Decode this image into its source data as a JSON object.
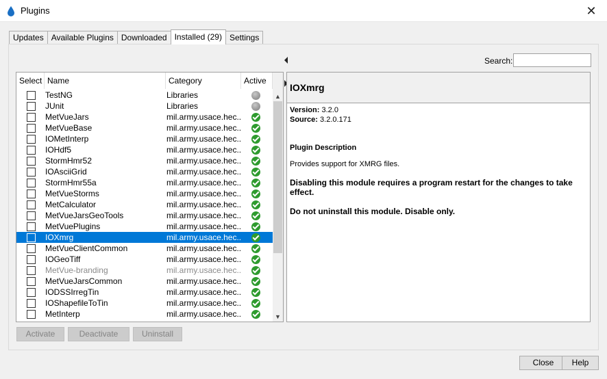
{
  "window": {
    "title": "Plugins"
  },
  "tabs": [
    {
      "label": "Updates"
    },
    {
      "label": "Available Plugins"
    },
    {
      "label": "Downloaded"
    },
    {
      "label": "Installed (29)"
    },
    {
      "label": "Settings"
    }
  ],
  "search": {
    "label": "Search:",
    "value": ""
  },
  "table": {
    "columns": [
      "Select",
      "Name",
      "Category",
      "Active"
    ],
    "rows": [
      {
        "name": "TestNG",
        "category": "Libraries",
        "active": "gray"
      },
      {
        "name": "JUnit",
        "category": "Libraries",
        "active": "gray"
      },
      {
        "name": "MetVueJars",
        "category": "mil.army.usace.hec...",
        "active": "green"
      },
      {
        "name": "MetVueBase",
        "category": "mil.army.usace.hec...",
        "active": "green"
      },
      {
        "name": "IOMetInterp",
        "category": "mil.army.usace.hec...",
        "active": "green"
      },
      {
        "name": "IOHdf5",
        "category": "mil.army.usace.hec...",
        "active": "green"
      },
      {
        "name": "StormHmr52",
        "category": "mil.army.usace.hec...",
        "active": "green"
      },
      {
        "name": "IOAsciiGrid",
        "category": "mil.army.usace.hec...",
        "active": "green"
      },
      {
        "name": "StormHmr55a",
        "category": "mil.army.usace.hec...",
        "active": "green"
      },
      {
        "name": "MetVueStorms",
        "category": "mil.army.usace.hec...",
        "active": "green"
      },
      {
        "name": "MetCalculator",
        "category": "mil.army.usace.hec...",
        "active": "green"
      },
      {
        "name": "MetVueJarsGeoTools",
        "category": "mil.army.usace.hec...",
        "active": "green"
      },
      {
        "name": "MetVuePlugins",
        "category": "mil.army.usace.hec...",
        "active": "green"
      },
      {
        "name": "IOXmrg",
        "category": "mil.army.usace.hec...",
        "active": "green",
        "selected": true
      },
      {
        "name": "MetVueClientCommon",
        "category": "mil.army.usace.hec...",
        "active": "green"
      },
      {
        "name": "IOGeoTiff",
        "category": "mil.army.usace.hec...",
        "active": "green"
      },
      {
        "name": "MetVue-branding",
        "category": "mil.army.usace.hec...",
        "active": "green",
        "dimmed": true
      },
      {
        "name": "MetVueJarsCommon",
        "category": "mil.army.usace.hec...",
        "active": "green"
      },
      {
        "name": "IODSSIrregTin",
        "category": "mil.army.usace.hec...",
        "active": "green"
      },
      {
        "name": "IOShapefileToTin",
        "category": "mil.army.usace.hec...",
        "active": "green"
      },
      {
        "name": "MetInterp",
        "category": "mil.army.usace.hec...",
        "active": "green"
      }
    ]
  },
  "detail": {
    "title": "IOXmrg",
    "version_label": "Version:",
    "version": "3.2.0",
    "source_label": "Source:",
    "source": "3.2.0.171",
    "description_title": "Plugin Description",
    "description": "Provides support for XMRG files.",
    "warning_restart": "Disabling this module requires a program restart for the changes to take effect.",
    "warning_uninstall": "Do not uninstall this module. Disable only."
  },
  "actions": {
    "activate": "Activate",
    "deactivate": "Deactivate",
    "uninstall": "Uninstall"
  },
  "footer": {
    "close": "Close",
    "help": "Help"
  },
  "colors": {
    "selection": "#0078d7",
    "active_green": "#2e9b2e"
  }
}
